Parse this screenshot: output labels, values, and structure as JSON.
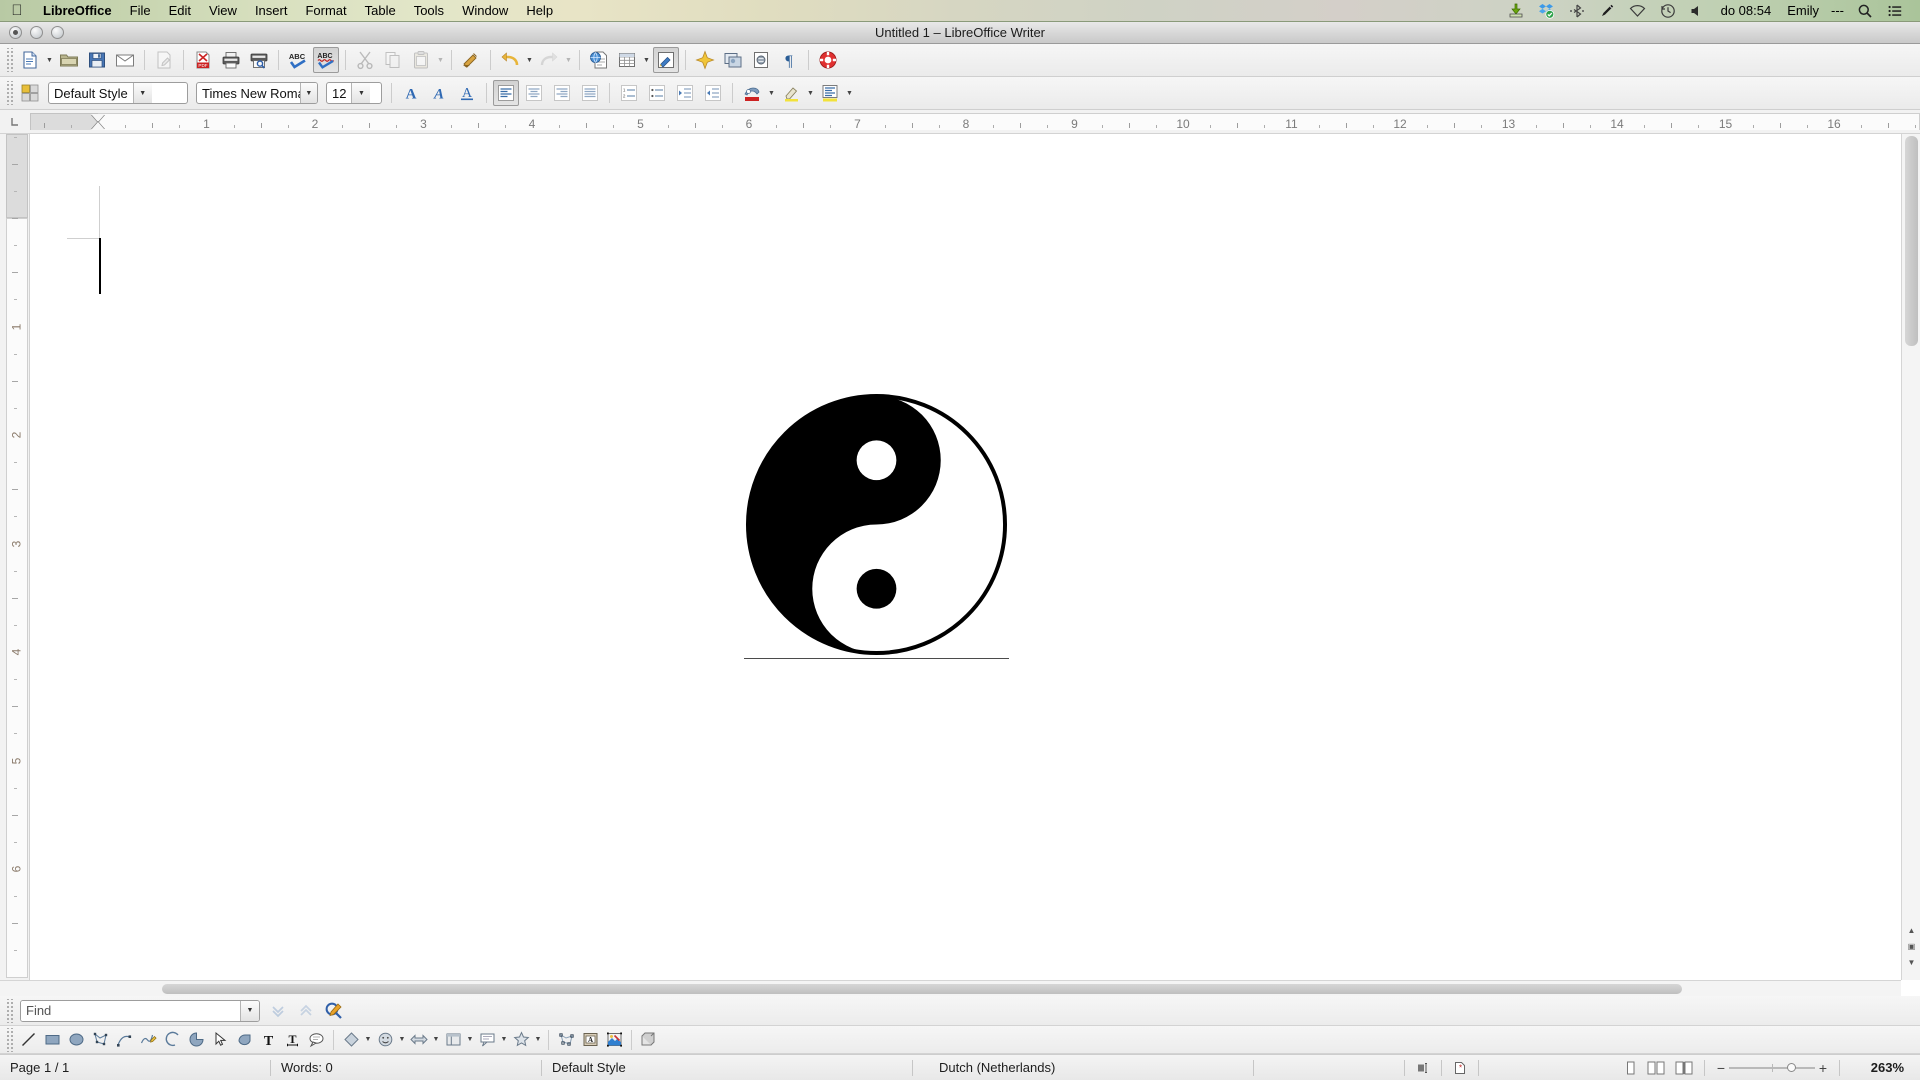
{
  "macmenu": {
    "apple_icon": "apple-icon",
    "items": [
      {
        "label": "LibreOffice",
        "bold": true
      },
      {
        "label": "File",
        "bold": false
      },
      {
        "label": "Edit",
        "bold": false
      },
      {
        "label": "View",
        "bold": false
      },
      {
        "label": "Insert",
        "bold": false
      },
      {
        "label": "Format",
        "bold": false
      },
      {
        "label": "Table",
        "bold": false
      },
      {
        "label": "Tools",
        "bold": false
      },
      {
        "label": "Window",
        "bold": false
      },
      {
        "label": "Help",
        "bold": false
      }
    ],
    "status_icons": [
      "download-arrow-icon",
      "dropbox-icon",
      "bluetooth-transfer-icon",
      "pen-icon",
      "wifi-icon",
      "time-machine-icon",
      "volume-icon"
    ],
    "clock": "do 08:54",
    "user": "Emily",
    "user_suffix": "---",
    "search_icon": "search-icon",
    "notification_icon": "notification-center-icon"
  },
  "titlebar": {
    "title": "Untitled 1 – LibreOffice Writer",
    "close_label": "close-window",
    "minimize_label": "minimize-window",
    "zoom_label": "zoom-window"
  },
  "toolbar_standard": {
    "items": [
      {
        "name": "new-document-button",
        "icon": "new-doc-icon",
        "enabled": true,
        "dropdown": true
      },
      {
        "name": "open-document-button",
        "icon": "open-folder-icon",
        "enabled": true
      },
      {
        "name": "save-document-button",
        "icon": "floppy-save-icon",
        "enabled": true
      },
      {
        "name": "email-document-button",
        "icon": "envelope-icon",
        "enabled": true
      },
      {
        "name": "edit-mode-button",
        "icon": "pencil-page-icon",
        "enabled": false
      },
      {
        "name": "export-pdf-button",
        "icon": "pdf-icon",
        "enabled": true
      },
      {
        "name": "print-button",
        "icon": "printer-icon",
        "enabled": true
      },
      {
        "name": "print-preview-button",
        "icon": "print-preview-icon",
        "enabled": true
      },
      {
        "name": "spelling-button",
        "icon": "abc-check-icon",
        "enabled": true
      },
      {
        "name": "autospellcheck-button",
        "icon": "abc-wave-icon",
        "enabled": true,
        "pressed": true
      },
      {
        "name": "cut-button",
        "icon": "scissors-icon",
        "enabled": false
      },
      {
        "name": "copy-button",
        "icon": "copy-icon",
        "enabled": false
      },
      {
        "name": "paste-button",
        "icon": "clipboard-icon",
        "enabled": false,
        "dropdown": true
      },
      {
        "name": "clone-formatting-button",
        "icon": "paintbrush-icon",
        "enabled": true
      },
      {
        "name": "undo-button",
        "icon": "undo-arrow-icon",
        "enabled": true,
        "dropdown": true
      },
      {
        "name": "redo-button",
        "icon": "redo-arrow-icon",
        "enabled": false,
        "dropdown": true
      },
      {
        "name": "insert-hyperlink-button",
        "icon": "globe-page-icon",
        "enabled": true
      },
      {
        "name": "insert-table-button",
        "icon": "table-grid-icon",
        "enabled": true,
        "dropdown": true
      },
      {
        "name": "show-draw-functions-button",
        "icon": "draw-brush-icon",
        "enabled": true,
        "pressed": true
      },
      {
        "name": "insert-special-character-button",
        "icon": "star-sparkle-icon",
        "enabled": true
      },
      {
        "name": "insert-frame-button",
        "icon": "frame-icon",
        "enabled": true
      },
      {
        "name": "insert-field-button",
        "icon": "field-icon",
        "enabled": true
      },
      {
        "name": "formatting-marks-button",
        "icon": "pilcrow-icon",
        "enabled": true
      },
      {
        "name": "help-button",
        "icon": "lifebuoy-icon",
        "enabled": true
      }
    ]
  },
  "toolbar_formatting": {
    "sidebar_toggle": {
      "name": "sidebar-settings-button",
      "icon": "four-squares-icon"
    },
    "paragraph_style": {
      "value": "Default Style",
      "name": "paragraph-style-combo"
    },
    "font_name": {
      "value": "Times New Roma",
      "name": "font-name-combo"
    },
    "font_size": {
      "value": "12",
      "name": "font-size-combo"
    },
    "items": [
      {
        "name": "bold-button",
        "icon": "bold-A-icon"
      },
      {
        "name": "italic-button",
        "icon": "italic-A-icon"
      },
      {
        "name": "underline-button",
        "icon": "underline-A-icon"
      },
      {
        "name": "align-left-button",
        "icon": "align-left-icon",
        "pressed": true
      },
      {
        "name": "align-center-button",
        "icon": "align-center-icon"
      },
      {
        "name": "align-right-button",
        "icon": "align-right-icon"
      },
      {
        "name": "align-justified-button",
        "icon": "align-justify-icon"
      },
      {
        "name": "ordered-list-button",
        "icon": "numbered-list-icon"
      },
      {
        "name": "unordered-list-button",
        "icon": "bullet-list-icon"
      },
      {
        "name": "decrease-indent-button",
        "icon": "decrease-indent-icon"
      },
      {
        "name": "increase-indent-button",
        "icon": "increase-indent-icon"
      },
      {
        "name": "font-color-button",
        "icon": "font-color-icon",
        "dropdown": true
      },
      {
        "name": "highlight-color-button",
        "icon": "highlighting-icon",
        "dropdown": true
      },
      {
        "name": "paragraph-background-button",
        "icon": "paragraph-background-icon",
        "dropdown": true
      }
    ]
  },
  "ruler": {
    "corner_icon": "tab-stop-left-icon",
    "horizontal_numbers": [
      1,
      2,
      3,
      4,
      5,
      6,
      7,
      8,
      9,
      10,
      11,
      12,
      13,
      14,
      15,
      16
    ],
    "vertical_numbers": [
      1,
      2,
      3,
      4,
      5,
      6
    ],
    "unit": "inch"
  },
  "document": {
    "image_name": "yin-yang-symbol",
    "image_alt": "Yin and yang taijitu symbol",
    "colors": {
      "yin": "#000000",
      "yang": "#ffffff",
      "outline": "#000000"
    },
    "baseline_color": "#4b4b4b",
    "caret_visible": true
  },
  "findbar": {
    "placeholder": "Find",
    "value": "",
    "find_next_icon": "find-next-icon",
    "find_previous_icon": "find-previous-icon",
    "find_replace_icon": "find-and-replace-icon"
  },
  "drawbar": {
    "items": [
      {
        "name": "insert-line-button",
        "icon": "line-icon"
      },
      {
        "name": "insert-rectangle-button",
        "icon": "rectangle-icon"
      },
      {
        "name": "insert-ellipse-button",
        "icon": "ellipse-icon"
      },
      {
        "name": "insert-polygon-button",
        "icon": "polygon-icon"
      },
      {
        "name": "insert-curve-button",
        "icon": "curve-icon"
      },
      {
        "name": "insert-freeform-line-button",
        "icon": "freeform-line-icon"
      },
      {
        "name": "insert-arc-button",
        "icon": "arc-icon"
      },
      {
        "name": "insert-circle-pie-button",
        "icon": "circle-pie-icon"
      },
      {
        "name": "select-button",
        "icon": "cursor-arrow-icon"
      },
      {
        "name": "insert-basic-shape-button",
        "icon": "basic-shape-icon"
      },
      {
        "name": "insert-textbox-button",
        "icon": "text-box-icon"
      },
      {
        "name": "insert-vertical-text-button",
        "icon": "vertical-text-icon"
      },
      {
        "name": "insert-callout-button",
        "icon": "callout-icon"
      },
      {
        "name": "basic-shapes-dropdown",
        "icon": "diamond-shape-icon",
        "dropdown": true
      },
      {
        "name": "symbol-shapes-dropdown",
        "icon": "smiley-shape-icon",
        "dropdown": true
      },
      {
        "name": "block-arrows-dropdown",
        "icon": "block-arrow-icon",
        "dropdown": true
      },
      {
        "name": "flowchart-dropdown",
        "icon": "flowchart-icon",
        "dropdown": true
      },
      {
        "name": "callout-shapes-dropdown",
        "icon": "callout-shape-icon",
        "dropdown": true
      },
      {
        "name": "stars-dropdown",
        "icon": "star-shape-icon",
        "dropdown": true
      },
      {
        "name": "points-button",
        "icon": "edit-points-icon"
      },
      {
        "name": "fontwork-button",
        "icon": "fontwork-icon"
      },
      {
        "name": "insert-image-button",
        "icon": "insert-image-icon"
      },
      {
        "name": "extrusion-button",
        "icon": "extrusion-3d-icon"
      }
    ]
  },
  "statusbar": {
    "page": "Page 1 / 1",
    "words": "Words: 0",
    "page_style": "Default Style",
    "language": "Dutch (Netherlands)",
    "insert_mode_icon": "insert-mode-icon",
    "selection_mode_icon": "selection-mode-icon",
    "unsaved_changes_icon": "unsaved-changes-icon",
    "view_layout": [
      {
        "name": "single-page-view-button",
        "icon": "single-page-icon"
      },
      {
        "name": "multi-page-view-button",
        "icon": "multi-page-icon"
      },
      {
        "name": "book-view-button",
        "icon": "book-view-icon"
      }
    ],
    "zoom_out_label": "−",
    "zoom_in_label": "+",
    "zoom_value": "263%"
  }
}
